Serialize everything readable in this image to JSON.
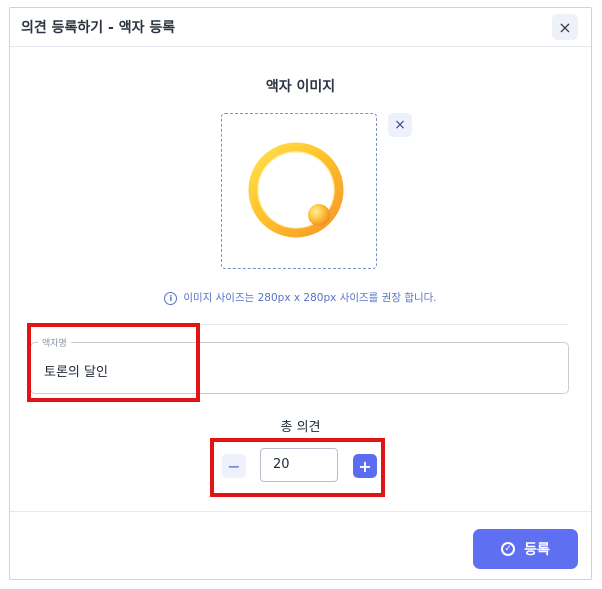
{
  "dialog": {
    "title": "의견 등록하기 - 액자 등록",
    "close_icon": "×"
  },
  "image_section": {
    "title": "액자 이미지",
    "remove_icon": "×",
    "hint_icon": "i",
    "hint": "이미지 사이즈는 280px x 280px 사이즈를 권장 합니다."
  },
  "name_field": {
    "label": "액자명",
    "value": "토론의 달인"
  },
  "count": {
    "label": "총 의견",
    "value": "20",
    "minus": "−",
    "plus": "+"
  },
  "footer": {
    "submit_label": "등록",
    "check_icon": "✓"
  },
  "colors": {
    "accent": "#5f6ff2",
    "highlight": "#e11414",
    "hint": "#5872c8"
  }
}
